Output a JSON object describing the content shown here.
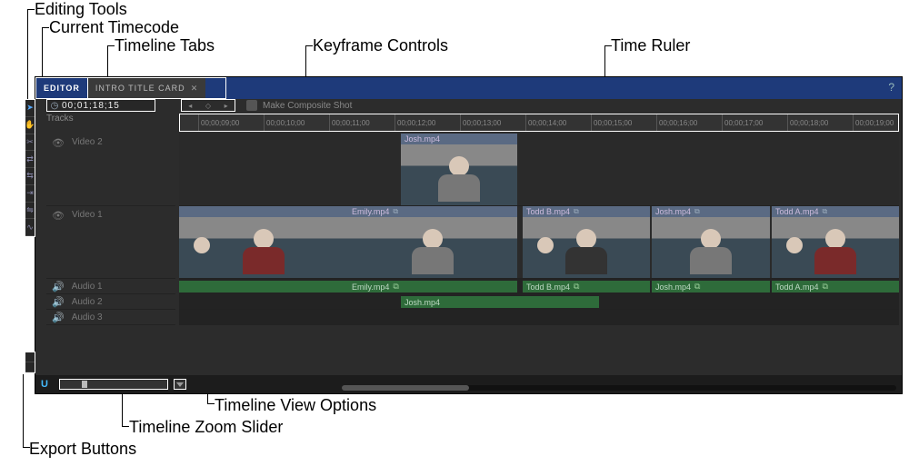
{
  "annotations": {
    "editing_tools": "Editing Tools",
    "current_timecode": "Current Timecode",
    "timeline_tabs": "Timeline Tabs",
    "keyframe_controls": "Keyframe Controls",
    "time_ruler": "Time Ruler",
    "timeline_view_options": "Timeline View Options",
    "timeline_zoom_slider": "Timeline Zoom Slider",
    "export_buttons": "Export Buttons"
  },
  "tabs": {
    "active": "EDITOR",
    "inactive": "INTRO TITLE CARD"
  },
  "timecode": "00;01;18;15",
  "make_composite_label": "Make Composite Shot",
  "tracks_label": "Tracks",
  "ruler_ticks": [
    "00;00;09;00",
    "00;00;10;00",
    "00;00;11;00",
    "00;00;12;00",
    "00;00;13;00",
    "00;00;14;00",
    "00;00;15;00",
    "00;00;16;00",
    "00;00;17;00",
    "00;00;18;00",
    "00;00;19;00"
  ],
  "tracks": {
    "video2": "Video 2",
    "video1": "Video 1",
    "audio1": "Audio 1",
    "audio2": "Audio 2",
    "audio3": "Audio 3"
  },
  "clips": {
    "v2_josh": "Josh.mp4",
    "v1_emily": "Emily.mp4",
    "v1_toddb": "Todd B.mp4",
    "v1_josh": "Josh.mp4",
    "v1_todda": "Todd A.mp4",
    "a1_emily": "Emily.mp4",
    "a1_toddb": "Todd B.mp4",
    "a1_josh": "Josh.mp4",
    "a1_todda": "Todd A.mp4",
    "a2_josh": "Josh.mp4"
  },
  "link_icon": "⧉"
}
